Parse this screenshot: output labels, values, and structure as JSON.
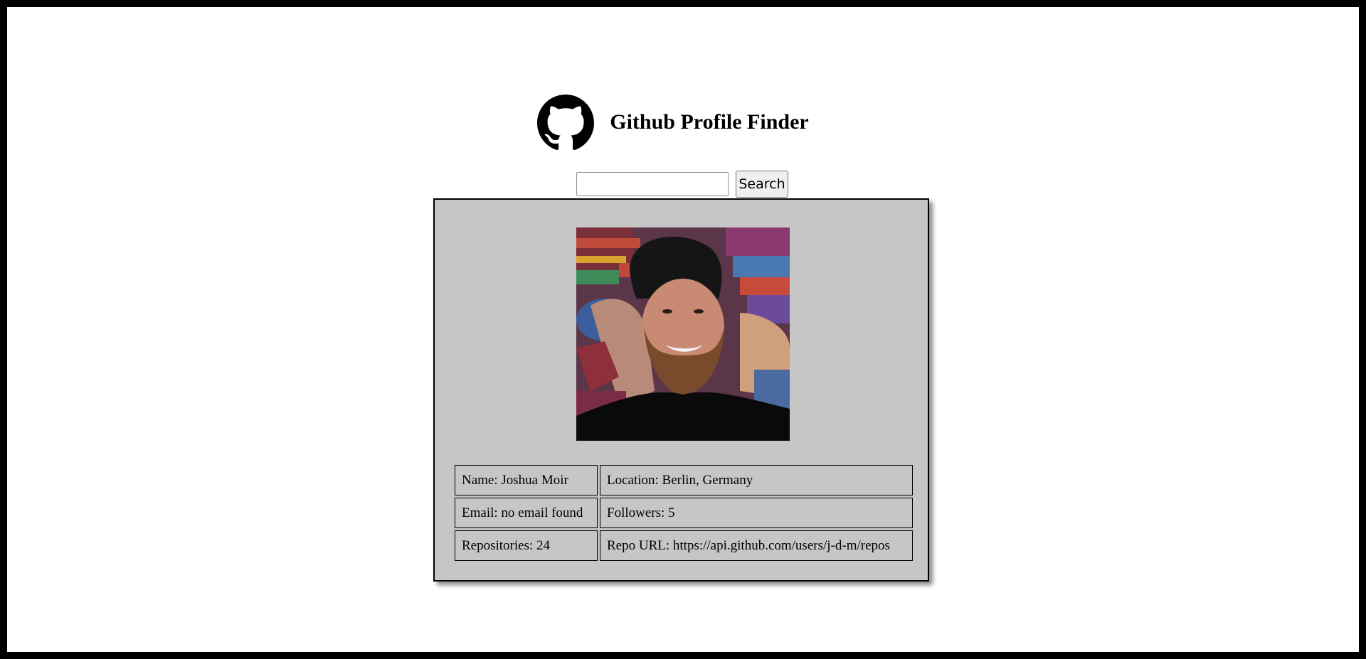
{
  "header": {
    "title": "Github Profile Finder",
    "logo_icon": "github-octocat-icon"
  },
  "search": {
    "value": "",
    "placeholder": "",
    "button_label": "Search"
  },
  "profile": {
    "avatar_description_icon": "user-avatar-photo",
    "rows": [
      [
        "Name: Joshua Moir",
        "Location: Berlin, Germany"
      ],
      [
        "Email: no email found",
        "Followers: 5"
      ],
      [
        "Repositories: 24",
        "Repo URL: https://api.github.com/users/j-d-m/repos"
      ]
    ]
  },
  "colors": {
    "page_border": "#000000",
    "background": "#ffffff",
    "card_background": "#c6c6c6"
  }
}
